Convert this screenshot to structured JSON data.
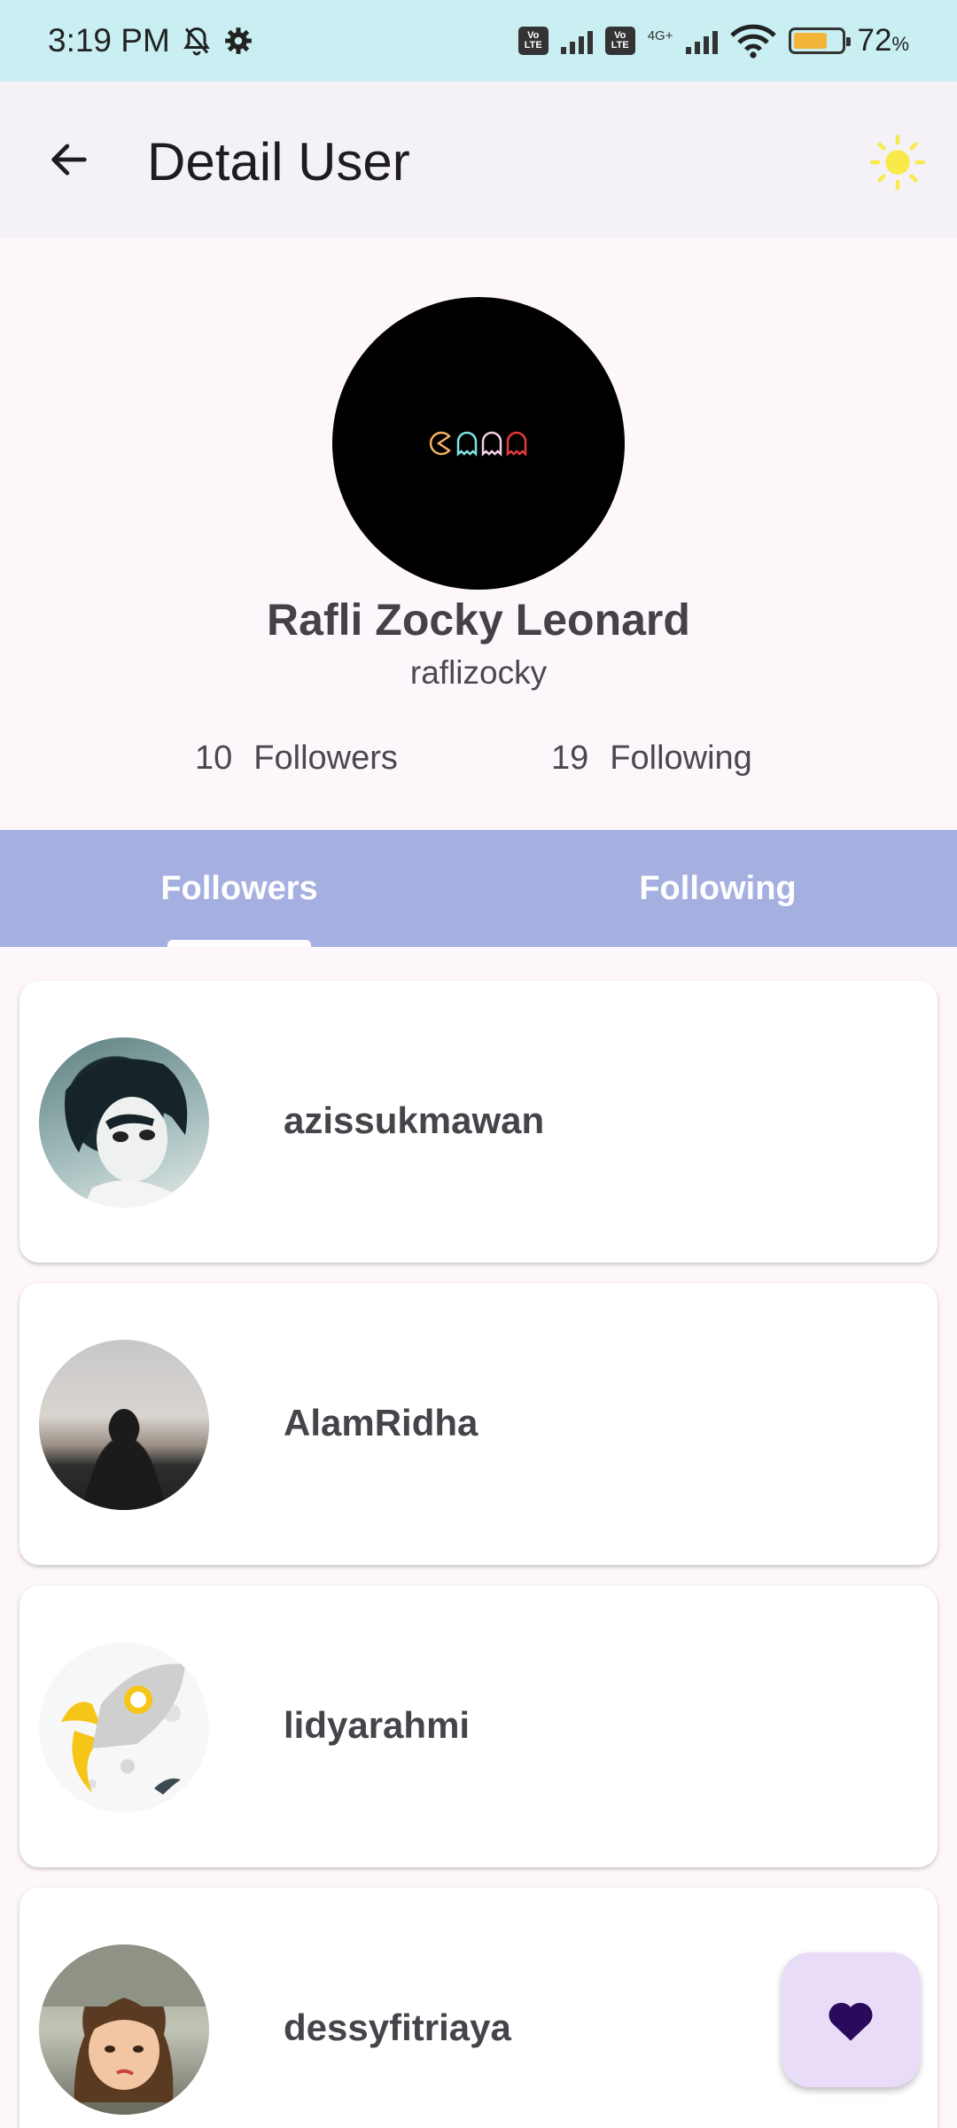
{
  "status_bar": {
    "time": "3:19 PM",
    "network": "4G+",
    "battery_level": 0.72,
    "battery_text": "72",
    "battery_unit": "%",
    "icons": [
      "mute-bell-icon",
      "gear-icon",
      "volte-icon",
      "signal-icon",
      "wifi-icon",
      "battery-icon"
    ]
  },
  "app_bar": {
    "title": "Detail User",
    "back_icon": "arrow-back-icon",
    "theme_icon": "sun-icon"
  },
  "profile": {
    "name": "Rafli Zocky Leonard",
    "username": "raflizocky",
    "followers_count": "10",
    "followers_label": "Followers",
    "following_count": "19",
    "following_label": "Following"
  },
  "tabs": [
    {
      "label": "Followers",
      "selected": true
    },
    {
      "label": "Following",
      "selected": false
    }
  ],
  "users": [
    {
      "login": "azissukmawan"
    },
    {
      "login": "AlamRidha"
    },
    {
      "login": "lidyarahmi"
    },
    {
      "login": "dessyfitriaya"
    }
  ],
  "fab": {
    "icon": "heart-icon"
  },
  "colors": {
    "status_bar": "#c9eff2",
    "app_bar": "#f4f1f7",
    "tab_bar": "#a5b0e1",
    "fab": "#e9dcf8",
    "heart": "#2a0a5c",
    "sun": "#f7ea4a"
  }
}
